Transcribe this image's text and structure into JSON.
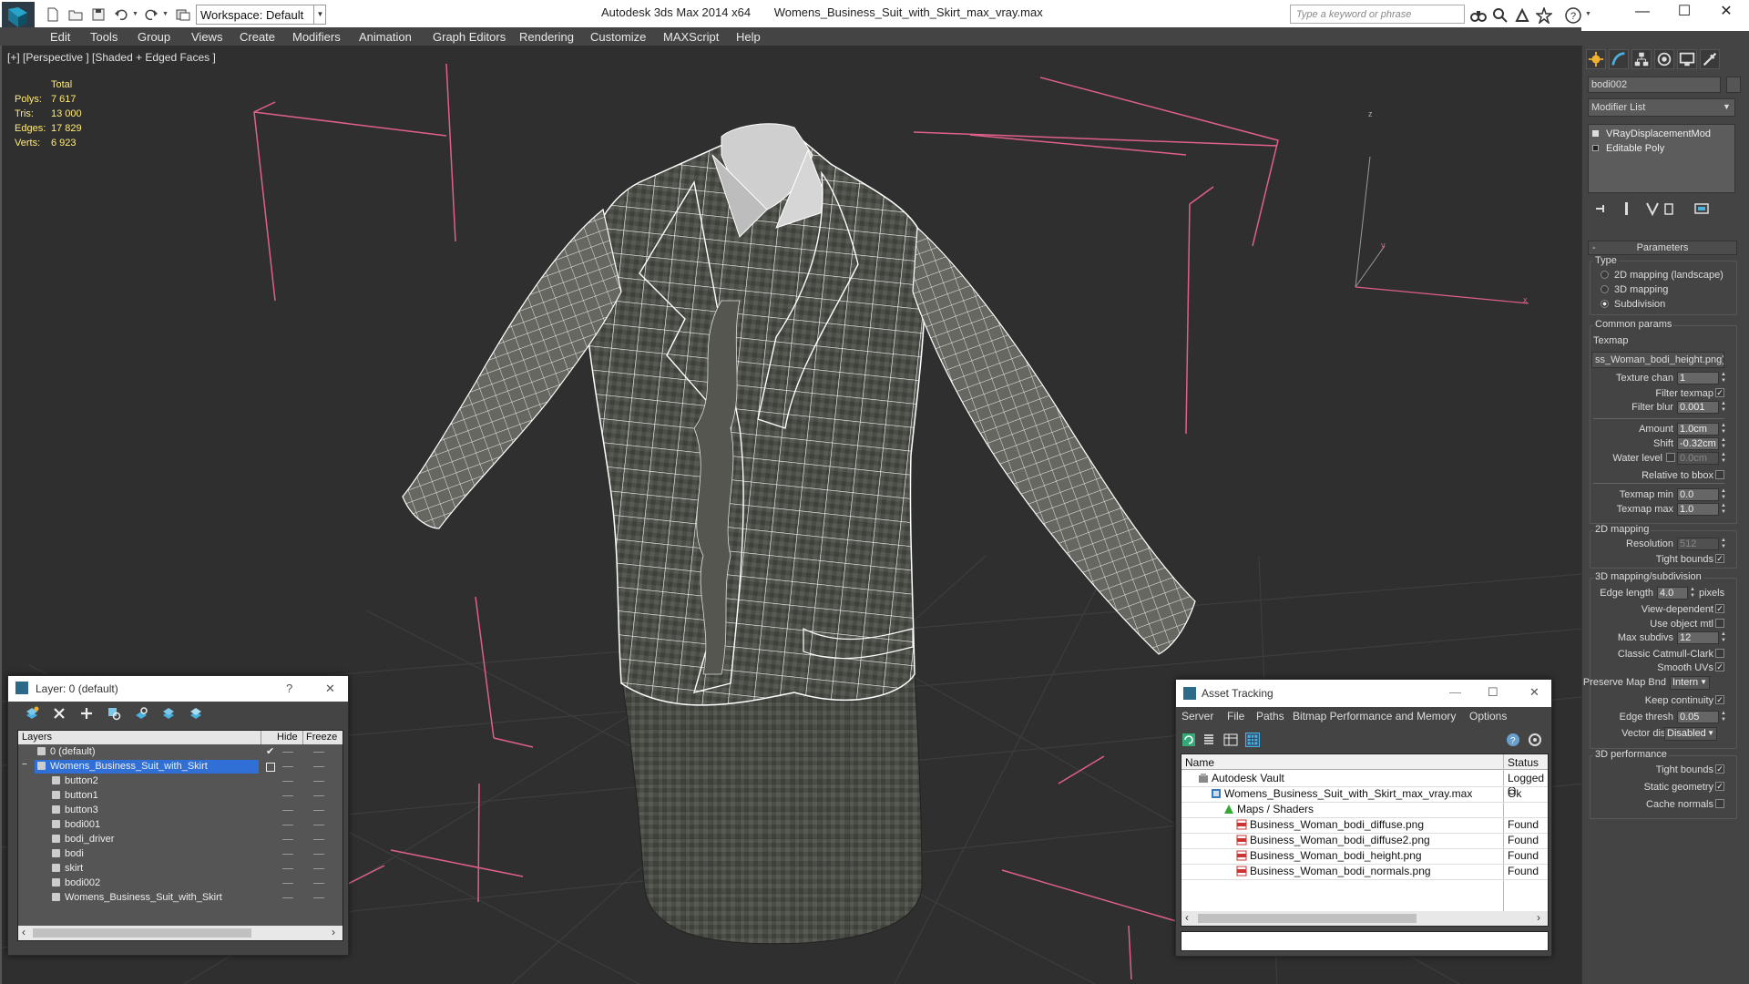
{
  "titlebar": {
    "workspace": "Workspace: Default",
    "app_name": "Autodesk 3ds Max  2014 x64",
    "file_name": "Womens_Business_Suit_with_Skirt_max_vray.max",
    "search_placeholder": "Type a keyword or phrase",
    "minimize": "—",
    "maximize": "☐",
    "close": "✕"
  },
  "menu": [
    "Edit",
    "Tools",
    "Group",
    "Views",
    "Create",
    "Modifiers",
    "Animation",
    "Graph Editors",
    "Rendering",
    "Customize",
    "MAXScript",
    "Help"
  ],
  "viewport": {
    "label": "[+] [Perspective ] [Shaded + Edged Faces ]",
    "stats_header": "Total",
    "stats": [
      {
        "label": "Polys:",
        "value": "7 617"
      },
      {
        "label": "Tris:",
        "value": "13 000"
      },
      {
        "label": "Edges:",
        "value": "17 829"
      },
      {
        "label": "Verts:",
        "value": "6 923"
      }
    ],
    "axis_x": "x",
    "axis_y": "y",
    "axis_z": "z"
  },
  "command_panel": {
    "object_name": "bodi002",
    "modifier_list": "Modifier List",
    "stack": [
      "VRayDisplacementMod",
      "Editable Poly"
    ],
    "parameters_title": "Parameters",
    "type_group": "Type",
    "type_options": [
      {
        "label": "2D mapping (landscape)",
        "selected": false
      },
      {
        "label": "3D mapping",
        "selected": false
      },
      {
        "label": "Subdivision",
        "selected": true
      }
    ],
    "common_group": "Common params",
    "texmap_label": "Texmap",
    "texmap_value": "ss_Woman_bodi_height.png)",
    "texture_chan_label": "Texture chan",
    "texture_chan_value": "1",
    "filter_texmap_label": "Filter texmap",
    "filter_blur_label": "Filter blur",
    "filter_blur_value": "0.001",
    "amount_label": "Amount",
    "amount_value": "1.0cm",
    "shift_label": "Shift",
    "shift_value": "-0.32cm",
    "water_level_label": "Water level",
    "water_level_value": "0.0cm",
    "relative_bbox_label": "Relative to bbox",
    "texmap_min_label": "Texmap min",
    "texmap_min_value": "0.0",
    "texmap_max_label": "Texmap max",
    "texmap_max_value": "1.0",
    "mapping2d_group": "2D mapping",
    "resolution_label": "Resolution",
    "resolution_value": "512",
    "tight_bounds_label": "Tight bounds",
    "mapping3d_group": "3D mapping/subdivision",
    "edge_length_label": "Edge length",
    "edge_length_value": "4.0",
    "pixels_label": "pixels",
    "view_dependent_label": "View-dependent",
    "use_object_mtl_label": "Use object mtl",
    "max_subdivs_label": "Max subdivs",
    "max_subdivs_value": "12",
    "classic_cc_label": "Classic Catmull-Clark",
    "smooth_uvs_label": "Smooth UVs",
    "preserve_map_label": "Preserve Map Bnd",
    "preserve_map_value": "Intern",
    "keep_continuity_label": "Keep continuity",
    "edge_thresh_label": "Edge thresh",
    "edge_thresh_value": "0.05",
    "vector_displ_label": "Vector displ",
    "vector_displ_value": "Disabled",
    "perf_group": "3D performance",
    "tight_bounds2_label": "Tight bounds",
    "static_geometry_label": "Static geometry",
    "cache_normals_label": "Cache normals",
    "check_mark": "✓"
  },
  "layer_dialog": {
    "title": "Layer: 0 (default)",
    "help": "?",
    "close": "✕",
    "columns": [
      "Layers",
      "Hide",
      "Freeze"
    ],
    "rows": [
      {
        "name": "0 (default)",
        "indent": 0,
        "selected": false
      },
      {
        "name": "Womens_Business_Suit_with_Skirt",
        "indent": 0,
        "selected": true
      },
      {
        "name": "button2",
        "indent": 1,
        "selected": false
      },
      {
        "name": "button1",
        "indent": 1,
        "selected": false
      },
      {
        "name": "button3",
        "indent": 1,
        "selected": false
      },
      {
        "name": "bodi001",
        "indent": 1,
        "selected": false
      },
      {
        "name": "bodi_driver",
        "indent": 1,
        "selected": false
      },
      {
        "name": "bodi",
        "indent": 1,
        "selected": false
      },
      {
        "name": "skirt",
        "indent": 1,
        "selected": false
      },
      {
        "name": "bodi002",
        "indent": 1,
        "selected": false
      },
      {
        "name": "Womens_Business_Suit_with_Skirt",
        "indent": 1,
        "selected": false
      }
    ],
    "scroll_left": "‹",
    "scroll_right": "›"
  },
  "asset_dialog": {
    "title": "Asset Tracking",
    "minimize": "—",
    "maximize": "☐",
    "close": "✕",
    "menu": [
      "Server",
      "File",
      "Paths",
      "Bitmap Performance and Memory",
      "Options"
    ],
    "columns": [
      "Name",
      "Status"
    ],
    "rows": [
      {
        "name": "Autodesk Vault",
        "status": "Logged O",
        "indent": 0,
        "icon": "vault-icon"
      },
      {
        "name": "Womens_Business_Suit_with_Skirt_max_vray.max",
        "status": "Ok",
        "indent": 1,
        "icon": "max-file-icon"
      },
      {
        "name": "Maps / Shaders",
        "status": "",
        "indent": 2,
        "icon": "maps-icon"
      },
      {
        "name": "Business_Woman_bodi_diffuse.png",
        "status": "Found",
        "indent": 3,
        "icon": "png-icon"
      },
      {
        "name": "Business_Woman_bodi_diffuse2.png",
        "status": "Found",
        "indent": 3,
        "icon": "png-icon"
      },
      {
        "name": "Business_Woman_bodi_height.png",
        "status": "Found",
        "indent": 3,
        "icon": "png-icon"
      },
      {
        "name": "Business_Woman_bodi_normals.png",
        "status": "Found",
        "indent": 3,
        "icon": "png-icon"
      }
    ],
    "scroll_left": "‹",
    "scroll_right": "›"
  },
  "colors": {
    "viewport_bg": "#2f2f2f",
    "stats_text": "#ffeb7a",
    "bbox_lines": "#e0608a",
    "selection": "#2f6fd6",
    "panel_bg": "#444444"
  }
}
